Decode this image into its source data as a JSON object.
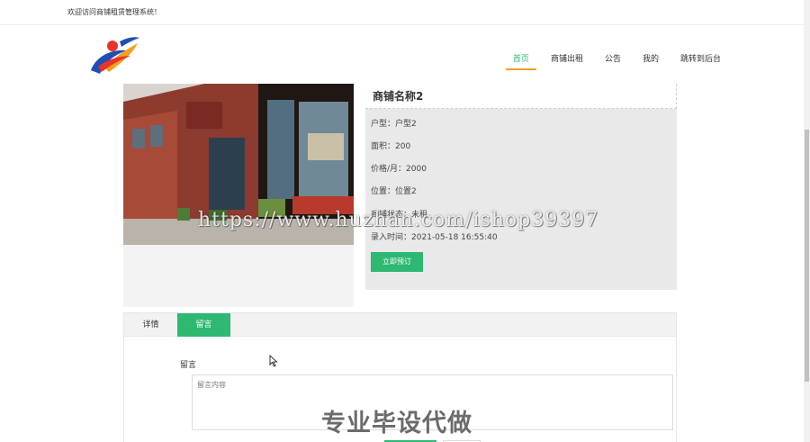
{
  "topbar": {
    "welcome": "欢迎访问商铺租赁管理系统！"
  },
  "nav": {
    "items": [
      {
        "label": "首页",
        "active": true
      },
      {
        "label": "商铺出租",
        "active": false
      },
      {
        "label": "公告",
        "active": false
      },
      {
        "label": "我的",
        "active": false
      },
      {
        "label": "跳转到后台",
        "active": false
      }
    ]
  },
  "shop": {
    "title": "商铺名称2",
    "rows": [
      {
        "key": "户型：",
        "value": "户型2"
      },
      {
        "key": "面积：",
        "value": "200"
      },
      {
        "key": "价格/月：",
        "value": "2000"
      },
      {
        "key": "位置：",
        "value": "位置2"
      },
      {
        "key": "商铺状态：",
        "value": "未租"
      },
      {
        "key": "录入时间：",
        "value": "2021-05-18 16:55:40"
      }
    ],
    "reserve_label": "立即预订"
  },
  "tabs": [
    {
      "label": "详情",
      "active": false
    },
    {
      "label": "留言",
      "active": true
    }
  ],
  "comment": {
    "label": "留言",
    "placeholder": "留言内容"
  },
  "watermarks": {
    "url": "https://www.huzhan.com/ishop39397",
    "promo": "专业毕设代做"
  },
  "colors": {
    "accent": "#2eb872",
    "nav_underline": "#f0a030"
  }
}
